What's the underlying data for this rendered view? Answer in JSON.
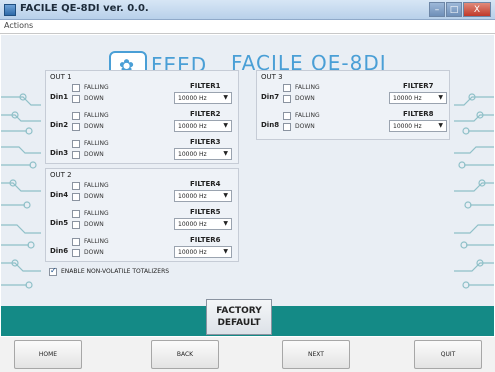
{
  "window": {
    "title": "FACILE QE-8DI ver. 0.0.",
    "minimize": "–",
    "maximize": "□",
    "close": "X"
  },
  "menu": {
    "actions": "Actions"
  },
  "logo": {
    "feed": "FEED",
    "facile": "FACILE QE-8DI"
  },
  "colors": {
    "accent": "#148a86",
    "logo": "#4a9fd6"
  },
  "out1": {
    "title": "OUT 1",
    "rows": [
      {
        "din": "Din1",
        "falling": "FALLING",
        "down": "DOWN",
        "filter": "FILTER1",
        "value": "10000 Hz"
      },
      {
        "din": "Din2",
        "falling": "FALLING",
        "down": "DOWN",
        "filter": "FILTER2",
        "value": "10000 Hz"
      },
      {
        "din": "Din3",
        "falling": "FALLING",
        "down": "DOWN",
        "filter": "FILTER3",
        "value": "10000 Hz"
      }
    ]
  },
  "out2": {
    "title": "OUT 2",
    "rows": [
      {
        "din": "Din4",
        "falling": "FALLING",
        "down": "DOWN",
        "filter": "FILTER4",
        "value": "10000 Hz"
      },
      {
        "din": "Din5",
        "falling": "FALLING",
        "down": "DOWN",
        "filter": "FILTER5",
        "value": "10000 Hz"
      },
      {
        "din": "Din6",
        "falling": "FALLING",
        "down": "DOWN",
        "filter": "FILTER6",
        "value": "10000 Hz"
      }
    ]
  },
  "out3": {
    "title": "OUT 3",
    "rows": [
      {
        "din": "Din7",
        "falling": "FALLING",
        "down": "DOWN",
        "filter": "FILTER7",
        "value": "10000 Hz"
      },
      {
        "din": "Din8",
        "falling": "FALLING",
        "down": "DOWN",
        "filter": "FILTER8",
        "value": "10000 Hz"
      }
    ]
  },
  "enable_totalizers": {
    "label": "ENABLE NON-VOLATILE TOTALIZERS",
    "checked": true
  },
  "factory_default": {
    "line1": "FACTORY",
    "line2": "DEFAULT"
  },
  "nav": {
    "home": "HOME",
    "back": "BACK",
    "next": "NEXT",
    "quit": "QUIT"
  }
}
